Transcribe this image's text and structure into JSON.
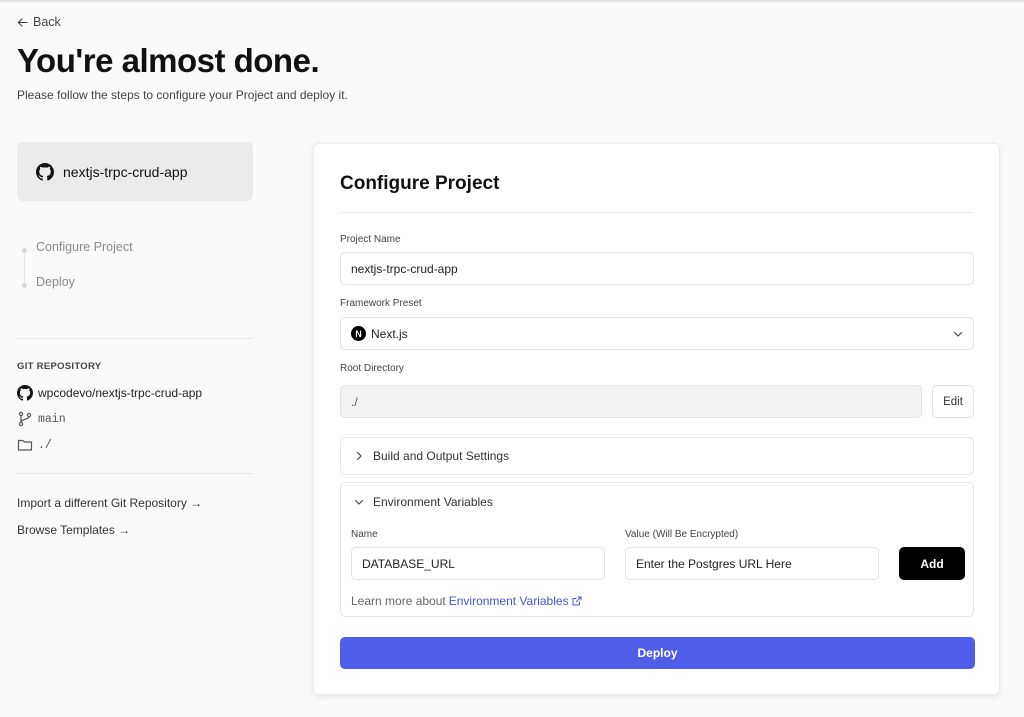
{
  "nav": {
    "back_label": "Back"
  },
  "header": {
    "title": "You're almost done.",
    "subtitle": "Please follow the steps to configure your Project and deploy it."
  },
  "sidebar": {
    "repo_card_name": "nextjs-trpc-crud-app",
    "steps": [
      "Configure Project",
      "Deploy"
    ],
    "git_heading": "GIT REPOSITORY",
    "git_repo": "wpcodevo/nextjs-trpc-crud-app",
    "git_branch": "main",
    "git_dir": "./",
    "links": [
      "Import a different Git Repository →",
      "Browse Templates →"
    ]
  },
  "configure": {
    "title": "Configure Project",
    "project_name_label": "Project Name",
    "project_name_value": "nextjs-trpc-crud-app",
    "framework_label": "Framework Preset",
    "framework_value": "Next.js",
    "framework_logo": "N",
    "root_dir_label": "Root Directory",
    "root_dir_value": "./",
    "edit_label": "Edit",
    "build_settings_label": "Build and Output Settings",
    "env_vars_label": "Environment Variables",
    "env_name_label": "Name",
    "env_name_value": "DATABASE_URL",
    "env_value_label": "Value (Will Be Encrypted)",
    "env_value_value": "Enter the Postgres URL Here",
    "add_label": "Add",
    "learn_more_prefix": "Learn more about",
    "learn_more_link": "Environment Variables",
    "deploy_label": "Deploy"
  },
  "colors": {
    "deploy_button": "#4f5ee8",
    "link": "#4455d6",
    "add_button": "#000000"
  }
}
